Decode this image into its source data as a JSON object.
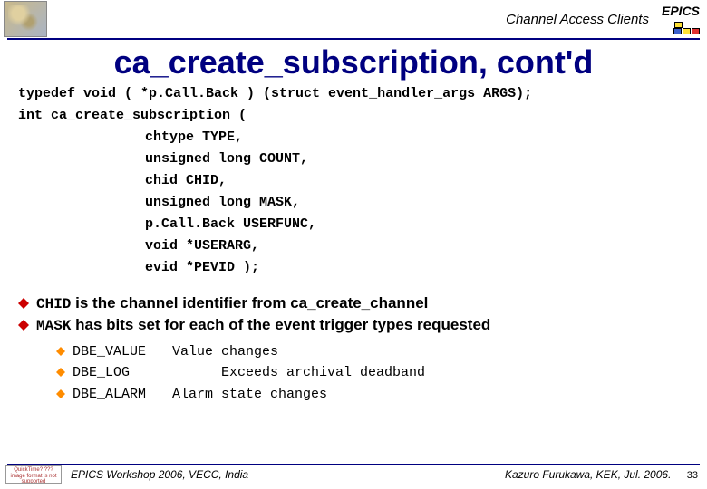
{
  "header": {
    "section": "Channel Access Clients",
    "brand": "EPICS"
  },
  "title": "ca_create_subscription, cont'd",
  "code": {
    "l1a": "typedef void ( *p.Call.Back ) (struct event_handler_args ",
    "l1b": "ARGS",
    "l1c": ");",
    "l2": "int ca_create_subscription (",
    "p1a": "chtype ",
    "p1b": "TYPE",
    "p1c": ",",
    "p2a": "unsigned long ",
    "p2b": "COUNT",
    "p2c": ",",
    "p3a": "chid ",
    "p3b": "CHID",
    "p3c": ",",
    "p4a": "unsigned long ",
    "p4b": "MASK",
    "p4c": ",",
    "p5a": "p.Call.Back ",
    "p5b": "USERFUNC",
    "p5c": ",",
    "p6a": "void *",
    "p6b": "USERARG",
    "p6c": ",",
    "p7a": "evid *",
    "p7b": "PEVID",
    "p7c": " );"
  },
  "bullet1": {
    "code": "CHID",
    "text": " is the channel identifier from ca_create_channel"
  },
  "bullet2": {
    "code": "MASK",
    "text": " has bits set for each of the event trigger types requested"
  },
  "sub": [
    {
      "name": "DBE_VALUE",
      "val": "Value changes"
    },
    {
      "name": "DBE_LOG",
      "val": "      Exceeds archival deadband"
    },
    {
      "name": "DBE_ALARM",
      "val": "Alarm state changes"
    }
  ],
  "footer": {
    "thumb": "QuickTime? ??? image format is not supported",
    "left": "EPICS Workshop 2006, VECC, India",
    "right": "Kazuro Furukawa, KEK, Jul. 2006.",
    "page": "33"
  }
}
